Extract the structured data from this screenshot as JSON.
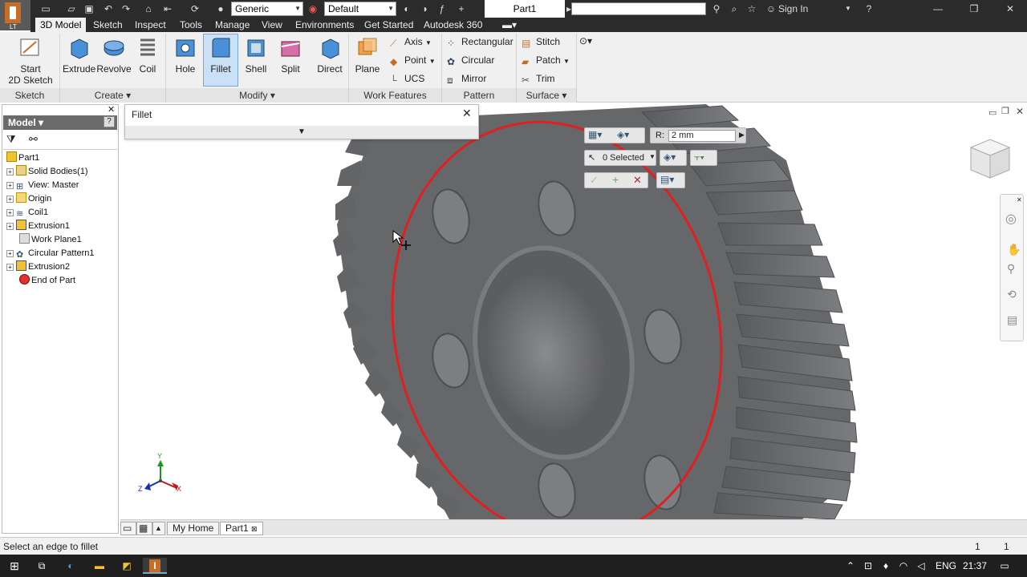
{
  "app": {
    "doc_title": "Part1",
    "sign_in": "Sign In",
    "search_placeholder": ""
  },
  "quick_access": {
    "material_combo": "Generic",
    "appearance_combo": "Default"
  },
  "tabs": [
    "3D Model",
    "Sketch",
    "Inspect",
    "Tools",
    "Manage",
    "View",
    "Environments",
    "Get Started",
    "Autodesk 360"
  ],
  "ribbon": {
    "start_sketch": "Start\n2D Sketch",
    "start_sketch_l1": "Start",
    "start_sketch_l2": "2D Sketch",
    "create": [
      "Extrude",
      "Revolve",
      "Coil"
    ],
    "modify": [
      "Hole",
      "Fillet",
      "Shell",
      "Split",
      "Direct"
    ],
    "plane": "Plane",
    "work_features": [
      "Axis",
      "Point",
      "UCS"
    ],
    "pattern": [
      "Rectangular",
      "Circular",
      "Mirror"
    ],
    "surface": [
      "Stitch",
      "Patch",
      "Trim"
    ],
    "panels": [
      "Sketch",
      "Create",
      "Modify",
      "Work Features",
      "Pattern",
      "Surface"
    ]
  },
  "browser": {
    "header": "Model",
    "items": [
      {
        "label": "Part1",
        "expander": ""
      },
      {
        "label": "Solid Bodies(1)",
        "expander": "+"
      },
      {
        "label": "View: Master",
        "expander": "+"
      },
      {
        "label": "Origin",
        "expander": "+"
      },
      {
        "label": "Coil1",
        "expander": "+"
      },
      {
        "label": "Extrusion1",
        "expander": "+"
      },
      {
        "label": "Work Plane1",
        "expander": ""
      },
      {
        "label": "Circular Pattern1",
        "expander": "+"
      },
      {
        "label": "Extrusion2",
        "expander": "+"
      },
      {
        "label": "End of Part",
        "expander": ""
      }
    ]
  },
  "fillet_dialog": {
    "title": "Fillet"
  },
  "mini_toolbar": {
    "radius_label": "R:",
    "radius_value": "2 mm",
    "selected": "0 Selected"
  },
  "doc_tabs": [
    "My Home",
    "Part1"
  ],
  "status": {
    "message": "Select an edge to fillet",
    "count1": "1",
    "count2": "1"
  },
  "taskbar": {
    "lang": "ENG",
    "time": "21:37"
  },
  "triad": {
    "x": "X",
    "y": "Y",
    "z": "Z"
  },
  "colors": {
    "accent_red": "#e02020",
    "gear": "#6a6b6e",
    "title_bar": "#2b2b2b",
    "selected_tool": "#c9e0f7"
  }
}
